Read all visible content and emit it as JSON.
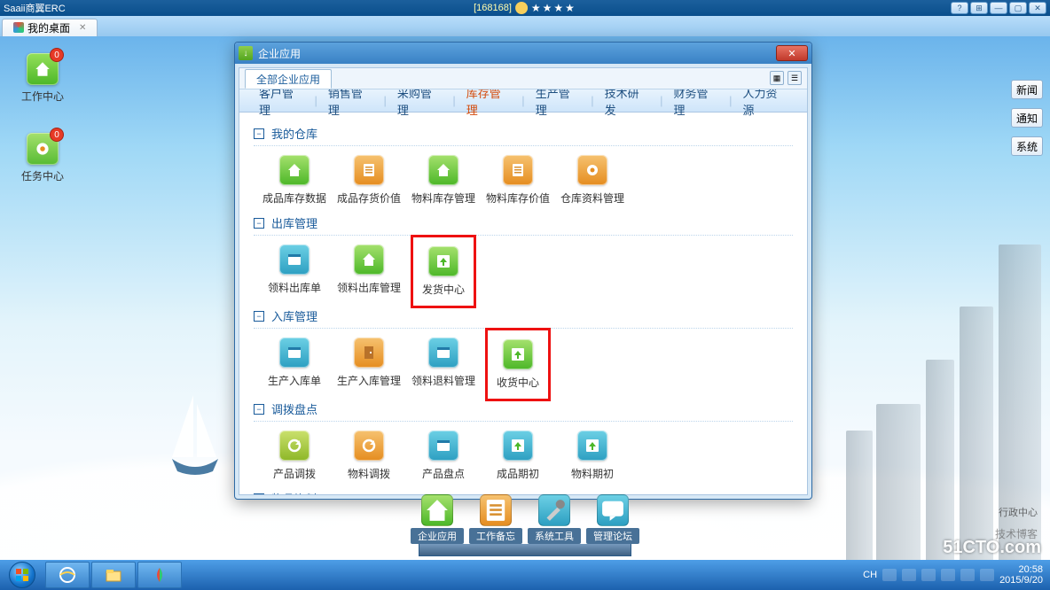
{
  "topbar": {
    "title": "Saaii商翼ERC",
    "center_code": "[168168]",
    "stars": "★★★★"
  },
  "topbuttons": [
    "?",
    "⊞",
    "—",
    "▢",
    "✕"
  ],
  "tabstrip": {
    "tab1": "我的桌面"
  },
  "desktop_icons": [
    {
      "label": "工作中心",
      "badge": "0"
    },
    {
      "label": "任务中心",
      "badge": "0"
    }
  ],
  "side_buttons": [
    "新闻",
    "通知",
    "系统"
  ],
  "window": {
    "title": "企业应用",
    "subtab": "全部企业应用",
    "nav": [
      "客户管理",
      "销售管理",
      "采购管理",
      "库存管理",
      "生产管理",
      "技术研发",
      "财务管理",
      "人力资源"
    ],
    "active_nav": "库存管理",
    "sections": [
      {
        "title": "我的仓库",
        "apps": [
          {
            "label": "成品库存数据",
            "icon": "house",
            "cls": "ic-green"
          },
          {
            "label": "成品存货价值",
            "icon": "sheet",
            "cls": "ic-orange"
          },
          {
            "label": "物料库存管理",
            "icon": "house",
            "cls": "ic-green"
          },
          {
            "label": "物料库存价值",
            "icon": "sheet",
            "cls": "ic-orange"
          },
          {
            "label": "仓库资料管理",
            "icon": "gear",
            "cls": "ic-orange"
          }
        ]
      },
      {
        "title": "出库管理",
        "apps": [
          {
            "label": "领料出库单",
            "icon": "card",
            "cls": "ic-teal"
          },
          {
            "label": "领料出库管理",
            "icon": "house",
            "cls": "ic-green"
          },
          {
            "label": "发货中心",
            "icon": "up",
            "cls": "ic-green",
            "hl": true
          }
        ]
      },
      {
        "title": "入库管理",
        "apps": [
          {
            "label": "生产入库单",
            "icon": "card",
            "cls": "ic-teal"
          },
          {
            "label": "生产入库管理",
            "icon": "door",
            "cls": "ic-orange"
          },
          {
            "label": "领料退料管理",
            "icon": "card",
            "cls": "ic-teal"
          },
          {
            "label": "收货中心",
            "icon": "up",
            "cls": "ic-green",
            "hl": true
          }
        ]
      },
      {
        "title": "调拨盘点",
        "apps": [
          {
            "label": "产品调拨",
            "icon": "cycle",
            "cls": "ic-lime"
          },
          {
            "label": "物料调拨",
            "icon": "cycle",
            "cls": "ic-orange"
          },
          {
            "label": "产品盘点",
            "icon": "card",
            "cls": "ic-teal"
          },
          {
            "label": "成品期初",
            "icon": "up",
            "cls": "ic-teal"
          },
          {
            "label": "物料期初",
            "icon": "up",
            "cls": "ic-teal"
          }
        ]
      },
      {
        "title": "物品资料",
        "apps": []
      }
    ]
  },
  "bigbar": [
    {
      "label": "企业应用",
      "cls": "ic-green",
      "icon": "house"
    },
    {
      "label": "工作备忘",
      "cls": "ic-orange",
      "icon": "sheet"
    },
    {
      "label": "系统工具",
      "cls": "ic-teal",
      "icon": "tools"
    },
    {
      "label": "管理论坛",
      "cls": "ic-teal",
      "icon": "chat"
    }
  ],
  "taskbar": {
    "lang": "CH",
    "time": "20:58",
    "date": "2015/9/20"
  },
  "watermark": "51CTO.com",
  "watermark2": "技术博客",
  "blabel": "行政中心"
}
